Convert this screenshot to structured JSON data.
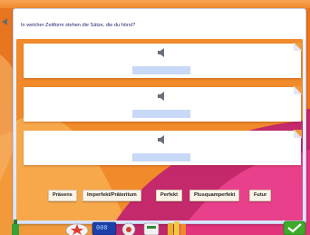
{
  "exercise": {
    "instruction": "In welcher Zeitform stehen die Sätze, die du hörst?",
    "sentences": [
      {
        "audio_icon": "speaker-icon",
        "answer": ""
      },
      {
        "audio_icon": "speaker-icon",
        "answer": ""
      },
      {
        "audio_icon": "speaker-icon",
        "answer": ""
      }
    ]
  },
  "word_bank": {
    "options": [
      "Präsens",
      "Imperfekt/Präteritum",
      "Perfekt",
      "Plusquamperfekt",
      "Futur"
    ]
  },
  "toolbar": {
    "items": [
      "bottle-icon",
      "star-cursor-icon",
      "tool-icon",
      "tool-icon",
      "book-icon",
      "check-icon"
    ],
    "counter_display": "000"
  },
  "colors": {
    "accent_orange": "#e8751f",
    "slot_blue": "#c7d9f7",
    "title_blue": "#1e1e6e",
    "check_green": "#3daa2a"
  }
}
